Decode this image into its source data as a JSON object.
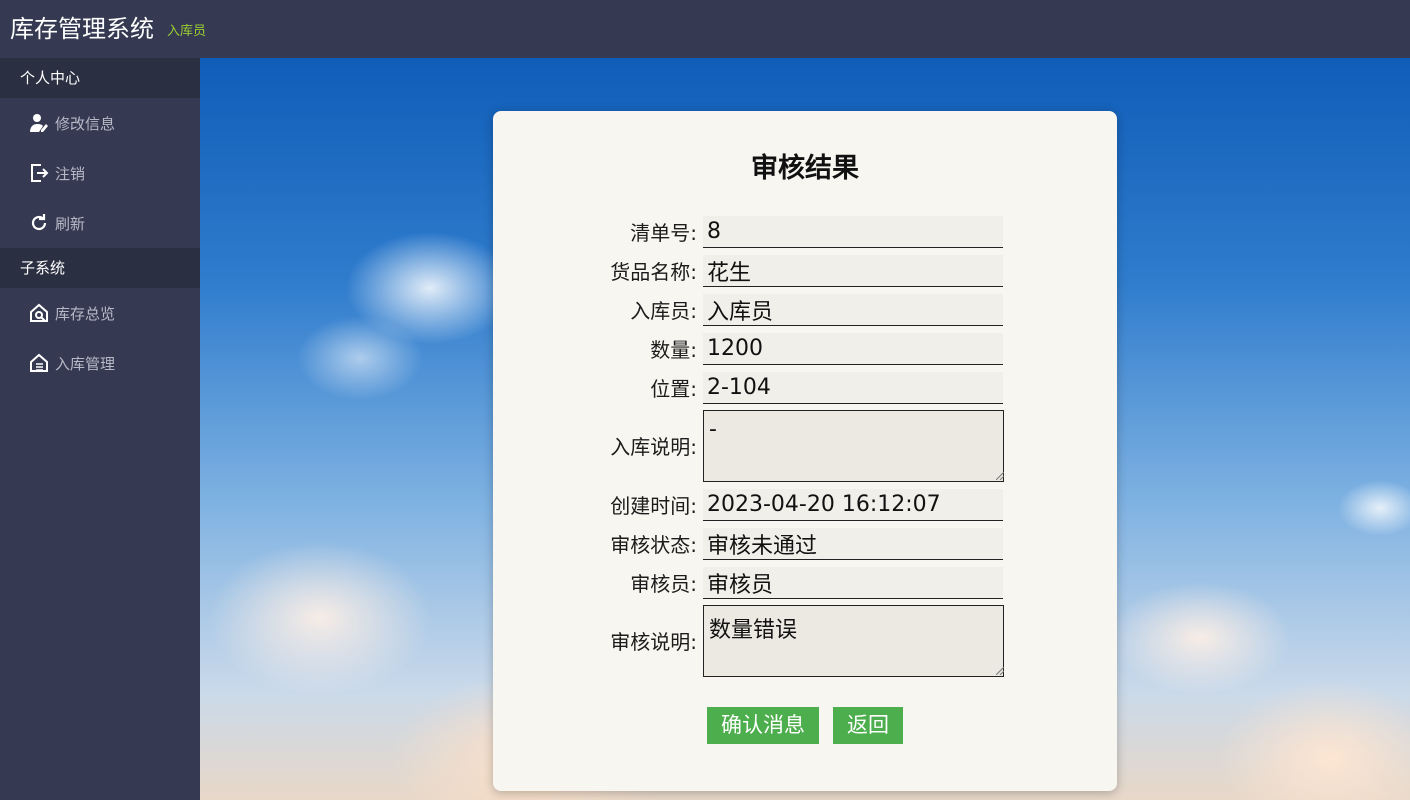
{
  "header": {
    "title": "库存管理系统",
    "role": "入库员"
  },
  "sidebar": {
    "sections": [
      {
        "label": "个人中心",
        "items": [
          {
            "label": "修改信息",
            "icon": "user-edit-icon"
          },
          {
            "label": "注销",
            "icon": "logout-icon"
          },
          {
            "label": "刷新",
            "icon": "refresh-icon"
          }
        ]
      },
      {
        "label": "子系统",
        "items": [
          {
            "label": "库存总览",
            "icon": "warehouse-search-icon"
          },
          {
            "label": "入库管理",
            "icon": "warehouse-inbound-icon"
          }
        ]
      }
    ]
  },
  "form": {
    "title": "审核结果",
    "fields": [
      {
        "label": "清单号:",
        "value": "8"
      },
      {
        "label": "货品名称:",
        "value": "花生"
      },
      {
        "label": "入库员:",
        "value": "入库员"
      },
      {
        "label": "数量:",
        "value": "1200"
      },
      {
        "label": "位置:",
        "value": "2-104"
      },
      {
        "label": "入库说明:",
        "value": "-"
      },
      {
        "label": "创建时间:",
        "value": "2023-04-20 16:12:07"
      },
      {
        "label": "审核状态:",
        "value": "审核未通过"
      },
      {
        "label": "审核员:",
        "value": "审核员"
      },
      {
        "label": "审核说明:",
        "value": "数量错误"
      }
    ],
    "buttons": {
      "confirm": "确认消息",
      "back": "返回"
    }
  },
  "colors": {
    "topbar": "#353a52",
    "sidebar": "#353a52",
    "section": "#2b2f42",
    "button": "#4cae4c",
    "role_badge": "#9acd32"
  }
}
